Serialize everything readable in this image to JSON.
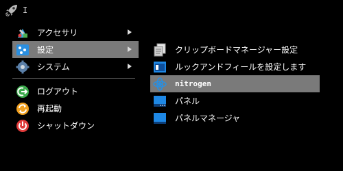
{
  "topbar": {
    "cursor_text": "I"
  },
  "menu": {
    "items": [
      {
        "label": "アクセサリ",
        "icon": "accessories-icon"
      },
      {
        "label": "設定",
        "icon": "settings-icon"
      },
      {
        "label": "システム",
        "icon": "system-gear-icon"
      },
      {
        "label": "ログアウト",
        "icon": "logout-icon"
      },
      {
        "label": "再起動",
        "icon": "restart-icon"
      },
      {
        "label": "シャットダウン",
        "icon": "shutdown-icon"
      }
    ]
  },
  "submenu": {
    "items": [
      {
        "label": "クリップボードマネージャー設定",
        "icon": "clipboard-icon"
      },
      {
        "label": "ルックアンドフィールを設定します",
        "icon": "look-and-feel-icon"
      },
      {
        "label": "nitrogen",
        "icon": "nitrogen-icon"
      },
      {
        "label": "パネル",
        "icon": "panel-icon"
      },
      {
        "label": "パネルマネージャ",
        "icon": "panel-manager-icon"
      }
    ]
  },
  "colors": {
    "selection": "#7a7a7a",
    "background": "#000000",
    "accent_blue": "#1e88e5"
  }
}
